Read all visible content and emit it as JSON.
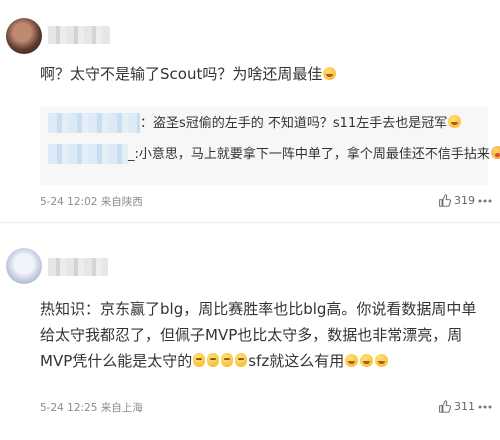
{
  "comments": [
    {
      "text_a": "啊？太守不是输了Scout吗？为啥还周最佳",
      "replies": [
        {
          "text": "：盗圣s冠偷的左手的 不知道吗？s11左手去也是冠军"
        },
        {
          "text": "_:小意思，马上就要拿下一阵中单了，拿个周最佳还不信手拈来"
        }
      ],
      "time": "5-24 12:02",
      "location": "来自陕西",
      "likes": "319"
    },
    {
      "text_a": "热知识：京东赢了blg，周比赛胜率也比blg高。你说看数据周中单给太守我都忍了，但佩子MVP也比太守多，数据也非常漂亮，周MVP凭什么能是太守的",
      "text_b": "sfz就这么有用",
      "time": "5-24 12:25",
      "location": "来自上海",
      "likes": "311"
    }
  ],
  "icons": {
    "like": "thumbs-up-icon",
    "more": "more-dots-icon",
    "emoji_laugh": "laughing-emoji",
    "emoji_red": "red-mouth-emoji",
    "emoji_kneel": "kneeling-emoji"
  },
  "colors": {
    "meta": "#8c8c8c",
    "reply_bg": "#f7f7f7",
    "text": "#333333"
  }
}
